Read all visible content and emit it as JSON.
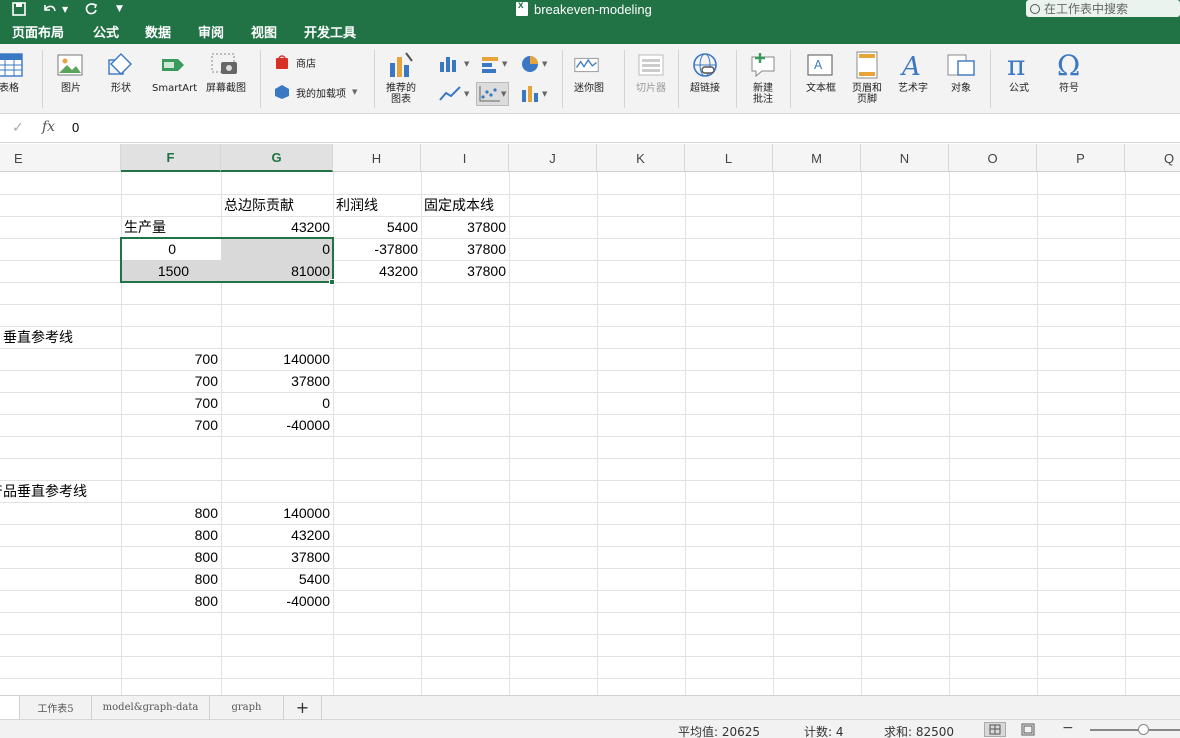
{
  "window": {
    "title": "breakeven-modeling",
    "search_placeholder": "在工作表中搜索"
  },
  "menu_tabs": [
    "页面布局",
    "公式",
    "数据",
    "审阅",
    "视图",
    "开发工具"
  ],
  "ribbon": {
    "table": "表格",
    "picture": "图片",
    "shapes": "形状",
    "smartart": "SmartArt",
    "screenshot": "屏幕截图",
    "store": "商店",
    "my_addins": "我的加载项",
    "recommended_charts": "推荐的\n图表",
    "sparklines": "迷你图",
    "slicer": "切片器",
    "hyperlink": "超链接",
    "new_comment": "新建\n批注",
    "textbox": "文本框",
    "header_footer": "页眉和\n页脚",
    "wordart": "艺术字",
    "object": "对象",
    "equation": "公式",
    "symbol": "符号"
  },
  "formula_bar": {
    "fx": "fx",
    "value": "0"
  },
  "columns": [
    "E",
    "F",
    "G",
    "H",
    "I",
    "J",
    "K",
    "L",
    "M",
    "N",
    "O",
    "P",
    "Q"
  ],
  "cells": {
    "G1": "总边际贡献",
    "H1": "利润线",
    "I1": "固定成本线",
    "F2": "生产量",
    "G2": "43200",
    "H2": "5400",
    "I2": "37800",
    "F3": "0",
    "G3": "0",
    "H3": "-37800",
    "I3": "37800",
    "F4": "1500",
    "G4": "81000",
    "H4": "43200",
    "I4": "37800",
    "E8": "垂直参考线",
    "F9": "700",
    "G9": "140000",
    "F10": "700",
    "G10": "37800",
    "F11": "700",
    "G11": "0",
    "F12": "700",
    "G12": "-40000",
    "E15": "产品垂直参考线",
    "F16": "800",
    "G16": "140000",
    "F17": "800",
    "G17": "43200",
    "F18": "800",
    "G18": "37800",
    "F19": "800",
    "G19": "5400",
    "F20": "800",
    "G20": "-40000"
  },
  "sheet_tabs": [
    "工作表5",
    "model&graph-data",
    "graph"
  ],
  "add_sheet": "+",
  "status": {
    "average": "平均值: 20625",
    "count": "计数: 4",
    "sum": "求和: 82500"
  },
  "colors": {
    "brand": "#217346",
    "selection": "#d9d9d9"
  }
}
